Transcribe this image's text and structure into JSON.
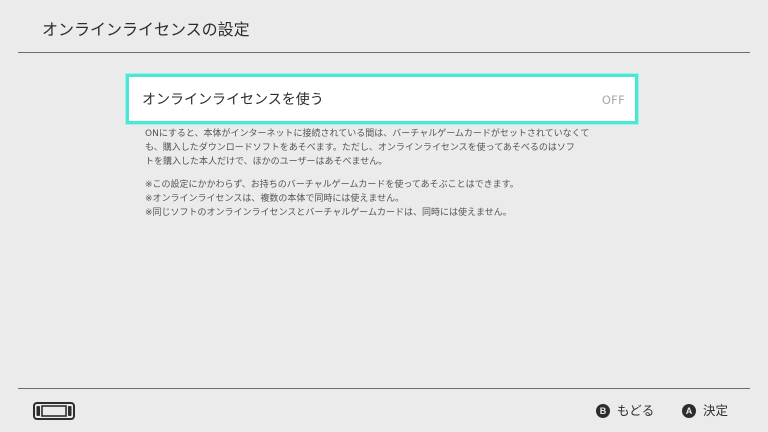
{
  "header": {
    "title": "オンラインライセンスの設定"
  },
  "setting": {
    "label": "オンラインライセンスを使う",
    "value": "OFF"
  },
  "description": {
    "paragraph1": [
      "ONにすると、本体がインターネットに接続されている間は、バーチャルゲームカードがセットされていなくて",
      "も、購入したダウンロードソフトをあそべます。ただし、オンラインライセンスを使ってあそべるのはソフ",
      "トを購入した本人だけで、ほかのユーザーはあそべません。"
    ],
    "notes": [
      "※この設定にかかわらず、お持ちのバーチャルゲームカードを使ってあそぶことはできます。",
      "※オンラインライセンスは、複数の本体で同時には使えません。",
      "※同じソフトのオンラインライセンスとバーチャルゲームカードは、同時には使えません。"
    ]
  },
  "footer": {
    "back_glyph": "B",
    "back_label": "もどる",
    "ok_glyph": "A",
    "ok_label": "決定"
  },
  "colors": {
    "background": "#ebebeb",
    "selection_border": "#4ce6d4",
    "text": "#2d2d2d",
    "value_text": "#a8a8a8"
  },
  "icons": {
    "console": "console-handheld-icon",
    "back": "b-button-icon",
    "ok": "a-button-icon"
  }
}
